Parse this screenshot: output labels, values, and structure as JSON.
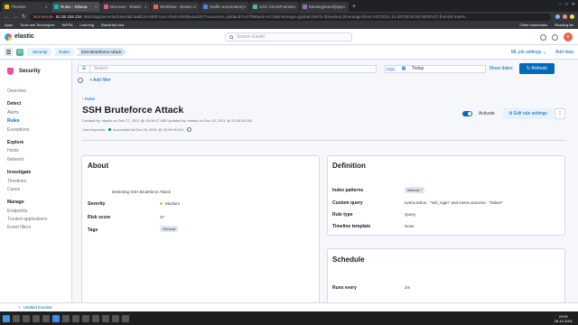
{
  "browser": {
    "tabs": [
      {
        "title": "TheHive",
        "color": "#f4b400"
      },
      {
        "title": "Rules - Kibana",
        "color": "#00bfb3",
        "active": true
      },
      {
        "title": "Discover - Elastic",
        "color": "#f04e98"
      },
      {
        "title": "Workflow - Elastic SIEM View",
        "color": "#e7664c"
      },
      {
        "title": "(traffic-automation) - Google Se",
        "color": "#4285f4"
      },
      {
        "title": "SOC ClientFramework.mkd.as.c",
        "color": "#54b399"
      },
      {
        "title": "Meetingsheet@pipeline.at.elas",
        "color": "#9170b8"
      }
    ],
    "new_tab": "+",
    "window_controls": [
      "–",
      "□",
      "✕"
    ],
    "nav_buttons": [
      "←",
      "→",
      "↻"
    ],
    "not_secure": "Not secure",
    "host": "52.35.106.234",
    "url_path": ":5601/app/security/rules/id/c3a8f120-6b8f-11ec-81eb-0b9f9a4e3207?sourcerer=(default:!%27filebeat-%27)&timerange=(global:(linkTo:!(timeline),timerange:(from:%272021-12-28T18:30:00.000Z%27,fromStr:now%...",
    "bookmarks": [
      "Apps",
      "Tools and Techniques",
      "INFRA",
      "Learning",
      "BlackHat Idea"
    ],
    "bookmarks_right": [
      "Other bookmarks",
      "Reading list"
    ]
  },
  "kibana": {
    "brand": "elastic",
    "search_placeholder": "Search Elastic",
    "avatar_initial": "e",
    "space_initial": "D",
    "breadcrumbs": [
      "Security",
      "Rules",
      "SSH Bruteforce Attack"
    ],
    "header_links": {
      "ml": "ML job settings ⌄",
      "add_data": "Add data"
    }
  },
  "sidebar": {
    "title": "Security",
    "overview": "Overview",
    "groups": [
      {
        "label": "Detect",
        "items": [
          "Alerts",
          "Rules",
          "Exceptions"
        ]
      },
      {
        "label": "Explore",
        "items": [
          "Hosts",
          "Network"
        ]
      },
      {
        "label": "Investigate",
        "items": [
          "Timelines",
          "Cases"
        ]
      },
      {
        "label": "Manage",
        "items": [
          "Endpoints",
          "Trusted applications",
          "Event filters"
        ]
      }
    ],
    "active": "Rules"
  },
  "querybar": {
    "placeholder": "Search",
    "date_badge": "KQL",
    "date_label": "Today",
    "show_dates": "Show dates",
    "refresh": "Refresh",
    "add_filter": "+ Add filter"
  },
  "rule": {
    "back": "‹  Rules",
    "title": "SSH Bruteforce Attack",
    "meta_created": "Created by: elastic on Dec 27, 2021 @ 15:08:37.485   Updated by: elastic on Dec 28, 2021 @ 22:36:38.284",
    "last_response_label": "Last response:",
    "last_response_value": "succeeded at Dec 28, 2021 @ 23:49:06.244",
    "activate_label": "Activate",
    "edit_label": "⚙  Edit rule settings",
    "more": "⋮",
    "enabled": true
  },
  "about": {
    "heading": "About",
    "description": "Detecting SSH Bruteforce Attack",
    "severity_label": "Severity",
    "severity_value": "Medium",
    "risk_label": "Risk score",
    "risk_value": "47",
    "tags_label": "Tags",
    "tag": "Filebeat"
  },
  "definition": {
    "heading": "Definition",
    "rows": [
      {
        "label": "Index patterns",
        "value": "filebeat-*"
      },
      {
        "label": "Custom query",
        "value": "event.action : \"ssh_login\" and event.outcome : \"failure\""
      },
      {
        "label": "Rule type",
        "value": "Query"
      },
      {
        "label": "Timeline template",
        "value": "None"
      }
    ]
  },
  "schedule": {
    "heading": "Schedule",
    "runs_label": "Runs every",
    "runs_value": "2m"
  },
  "footer": {
    "timeline": "Untitled timeline",
    "timeline_plus": "+"
  },
  "taskbar": {
    "time": "23:50",
    "date": "28-12-2021"
  },
  "colors": {
    "accent": "#006bb8",
    "success": "#017d73",
    "severity_medium": "#d6bf57"
  }
}
